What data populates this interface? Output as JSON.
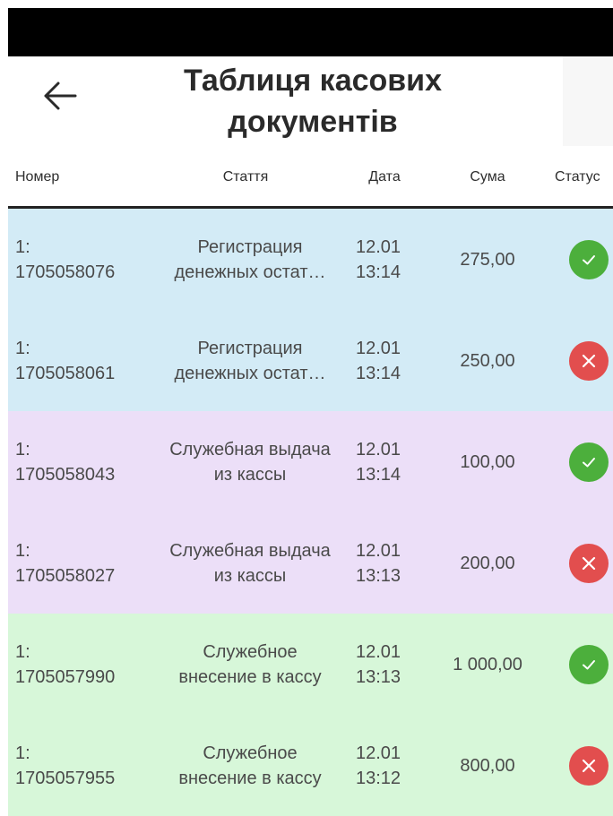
{
  "header": {
    "title": "Таблиця касових документів"
  },
  "table": {
    "columns": {
      "number": "Номер",
      "article": "Стаття",
      "date": "Дата",
      "sum": "Сума",
      "status": "Статус"
    },
    "rows": [
      {
        "number": "1:\n1705058076",
        "article": "Регистрация\nденежных остат…",
        "date": "12.01\n13:14",
        "sum": "275,00",
        "status": "ok",
        "bg": "#d3ebf6"
      },
      {
        "number": "1:\n1705058061",
        "article": "Регистрация\nденежных остат…",
        "date": "12.01\n13:14",
        "sum": "250,00",
        "status": "error",
        "bg": "#d3ebf6"
      },
      {
        "number": "1:\n1705058043",
        "article": "Служебная выдача\nиз кассы",
        "date": "12.01\n13:14",
        "sum": "100,00",
        "status": "ok",
        "bg": "#ecdff8"
      },
      {
        "number": "1:\n1705058027",
        "article": "Служебная выдача\nиз кассы",
        "date": "12.01\n13:13",
        "sum": "200,00",
        "status": "error",
        "bg": "#ecdff8"
      },
      {
        "number": "1:\n1705057990",
        "article": "Служебное\nвнесение в кассу",
        "date": "12.01\n13:13",
        "sum": "1 000,00",
        "status": "ok",
        "bg": "#d7f7d9"
      },
      {
        "number": "1:\n1705057955",
        "article": "Служебное\nвнесение в кассу",
        "date": "12.01\n13:12",
        "sum": "800,00",
        "status": "error",
        "bg": "#d7f7d9"
      }
    ]
  },
  "colors": {
    "ok": "#4caf3c",
    "error": "#e24e4e",
    "header_border": "#222222"
  },
  "icons": {
    "back": "arrow-left-icon",
    "ok": "check-icon",
    "error": "cross-icon"
  }
}
